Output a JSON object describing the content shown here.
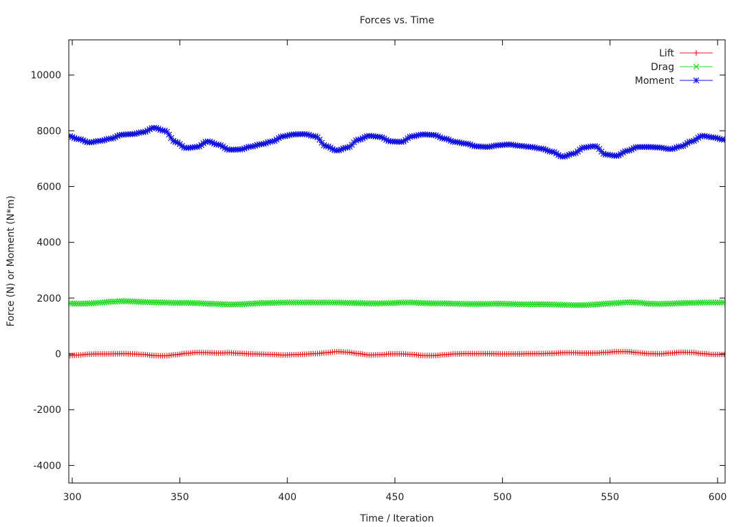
{
  "chart_data": {
    "type": "line",
    "title": "Forces vs. Time",
    "xlabel": "Time / Iteration",
    "ylabel": "Force (N) or Moment (N*m)",
    "xlim": [
      298.4,
      603.5
    ],
    "ylim": [
      -4630,
      11260
    ],
    "xticks": [
      300,
      350,
      400,
      450,
      500,
      550,
      600
    ],
    "xtick_labels": [
      "300",
      "350",
      "400",
      "450",
      "500",
      "550",
      "600"
    ],
    "yticks": [
      -4000,
      -2000,
      0,
      2000,
      4000,
      6000,
      8000,
      10000
    ],
    "ytick_labels": [
      "-4000",
      "-2000",
      "0",
      "2000",
      "4000",
      "6000",
      "8000",
      "10000"
    ],
    "grid": false,
    "legend_position": "top-right",
    "x": [
      298,
      303,
      308,
      313,
      318,
      323,
      328,
      333,
      338,
      343,
      348,
      353,
      358,
      363,
      368,
      373,
      378,
      383,
      388,
      393,
      398,
      403,
      408,
      413,
      418,
      423,
      428,
      433,
      438,
      443,
      448,
      453,
      458,
      463,
      468,
      473,
      478,
      483,
      488,
      493,
      498,
      503,
      508,
      513,
      518,
      523,
      528,
      533,
      538,
      543,
      548,
      553,
      558,
      563,
      568,
      573,
      578,
      583,
      588,
      593,
      598,
      603
    ],
    "series": [
      {
        "name": "Lift",
        "color": "#e41a1c",
        "marker": "plus",
        "values": [
          -60,
          -40,
          -10,
          0,
          0,
          10,
          0,
          -20,
          -60,
          -70,
          -30,
          20,
          50,
          40,
          30,
          40,
          20,
          0,
          -10,
          -20,
          -40,
          -30,
          -10,
          10,
          40,
          80,
          60,
          10,
          -40,
          -30,
          0,
          0,
          -20,
          -60,
          -60,
          -30,
          0,
          10,
          10,
          10,
          0,
          0,
          0,
          10,
          10,
          20,
          40,
          40,
          30,
          30,
          50,
          80,
          80,
          40,
          10,
          0,
          30,
          60,
          50,
          10,
          -20,
          -20
        ]
      },
      {
        "name": "Drag",
        "color": "#1ed91e",
        "marker": "cross",
        "values": [
          1810,
          1800,
          1810,
          1840,
          1870,
          1890,
          1880,
          1860,
          1850,
          1840,
          1830,
          1830,
          1820,
          1800,
          1790,
          1770,
          1780,
          1800,
          1820,
          1830,
          1840,
          1840,
          1840,
          1840,
          1840,
          1840,
          1830,
          1820,
          1810,
          1810,
          1820,
          1840,
          1840,
          1820,
          1810,
          1810,
          1800,
          1790,
          1790,
          1790,
          1800,
          1790,
          1780,
          1780,
          1780,
          1770,
          1760,
          1750,
          1750,
          1770,
          1800,
          1820,
          1850,
          1840,
          1800,
          1790,
          1800,
          1820,
          1830,
          1840,
          1840,
          1840
        ]
      },
      {
        "name": "Moment",
        "color": "#1010e0",
        "marker": "star",
        "values": [
          7820,
          7700,
          7580,
          7640,
          7720,
          7860,
          7880,
          7950,
          8110,
          8000,
          7600,
          7380,
          7420,
          7620,
          7500,
          7320,
          7330,
          7430,
          7520,
          7620,
          7800,
          7870,
          7880,
          7800,
          7450,
          7290,
          7400,
          7680,
          7820,
          7780,
          7620,
          7600,
          7800,
          7870,
          7850,
          7720,
          7600,
          7540,
          7440,
          7420,
          7480,
          7510,
          7460,
          7420,
          7360,
          7250,
          7070,
          7180,
          7400,
          7450,
          7150,
          7100,
          7280,
          7420,
          7420,
          7400,
          7340,
          7440,
          7620,
          7820,
          7760,
          7680
        ]
      }
    ]
  }
}
